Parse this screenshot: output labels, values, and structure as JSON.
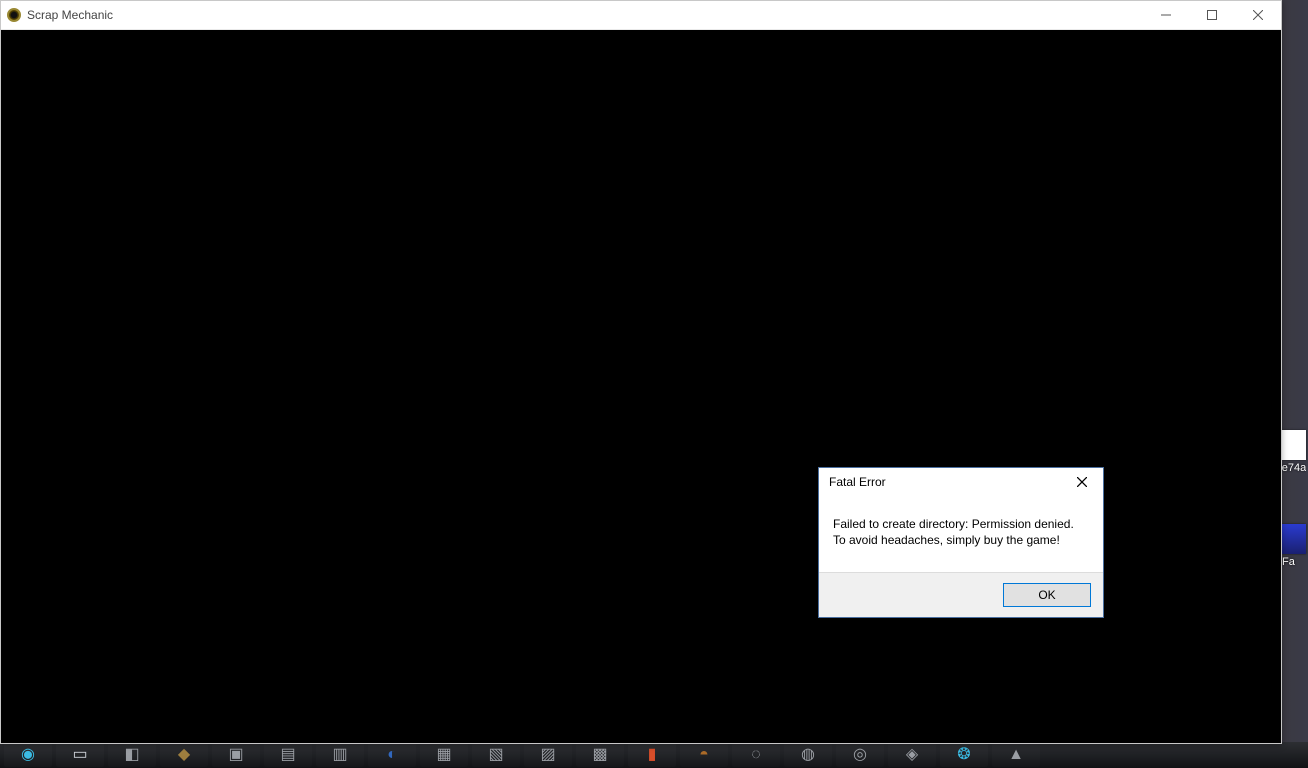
{
  "app": {
    "title": "Scrap Mechanic"
  },
  "dialog": {
    "title": "Fatal Error",
    "message_line1": "Failed to create directory: Permission denied.",
    "message_line2": "To avoid headaches, simply buy the game!",
    "ok_label": "OK"
  },
  "desktop": {
    "right_label_1": "e74a",
    "right_label_2": "Fa"
  }
}
